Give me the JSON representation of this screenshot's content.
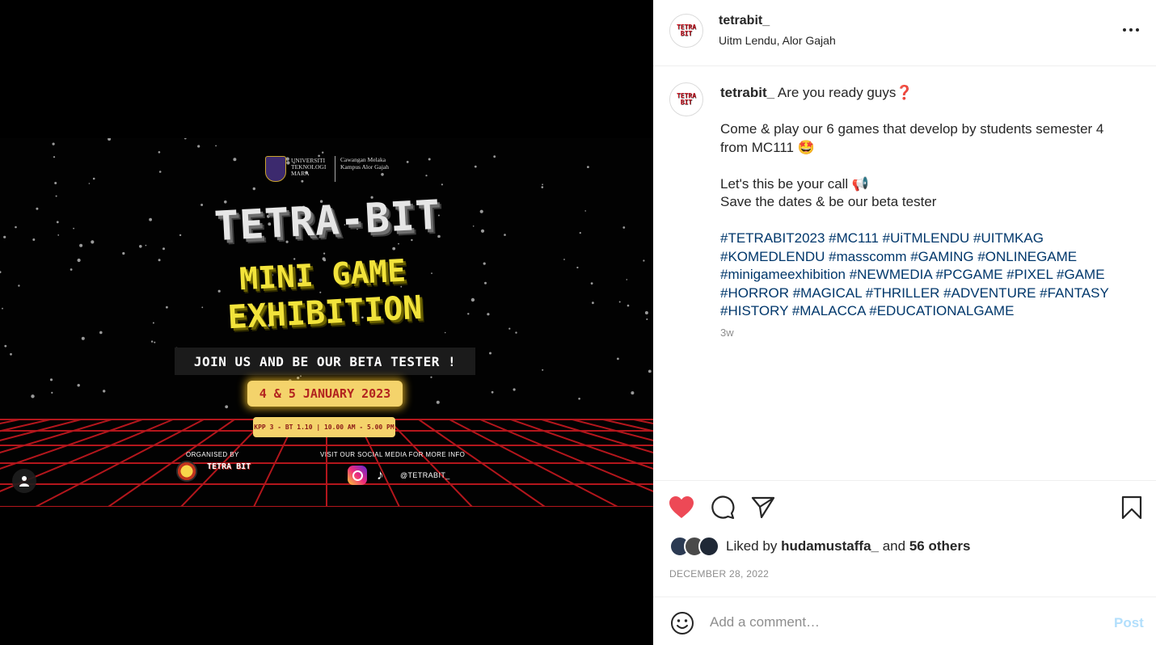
{
  "poster": {
    "uni_name": "UNIVERSITI TEKNOLOGI MARA",
    "uni_campus": "Cawangan Melaka Kampus Alor Gajah",
    "title": "TETRA-BIT",
    "subtitle_1": "MINI GAME",
    "subtitle_2": "EXHIBITION",
    "join_text": "JOIN US AND BE OUR BETA TESTER !",
    "date_text": "4 & 5 JANUARY 2023",
    "venue_time": "KPP 3 - BT 1.10 | 10.00 AM - 5.00 PM",
    "organised_by": "ORGANISED BY",
    "organiser_logo_text": "TETRA BIT",
    "social_label": "VISIT OUR SOCIAL MEDIA FOR MORE INFO",
    "social_handle": "@TETRABIT_",
    "colors": {
      "grid": "#b3161c",
      "title_yellow": "#f2e33b",
      "pill": "#f4d36b"
    }
  },
  "header": {
    "username": "tetrabit_",
    "location": "Uitm Lendu, Alor Gajah",
    "avatar_text": "TETRA BIT",
    "more_icon": "more-horizontal-icon"
  },
  "caption": {
    "username": "tetrabit_",
    "line1": "Are you ready guys❓",
    "line2": "Come & play our 6 games that develop by students semester 4 from MC111 🤩",
    "line3": "Let's this be your call 📢",
    "line4": "Save the dates & be our beta tester",
    "hashtags": "#TETRABIT2023 #MC111 #UiTMLENDU #UITMKAG #KOMEDLENDU #masscomm #GAMING #ONLINEGAME #minigameexhibition #NEWMEDIA #PCGAME #PIXEL #GAME #HORROR #MAGICAL #THRILLER #ADVENTURE #FANTASY #HISTORY #MALACCA #EDUCATIONALGAME",
    "time_ago": "3w"
  },
  "actions": {
    "liked_prefix": "Liked by",
    "liked_user": "hudamustaffa_",
    "liked_and": "and",
    "liked_others": "56 others",
    "date": "DECEMBER 28, 2022",
    "like_color": "#ed4956"
  },
  "comment": {
    "placeholder": "Add a comment…",
    "post_label": "Post"
  }
}
